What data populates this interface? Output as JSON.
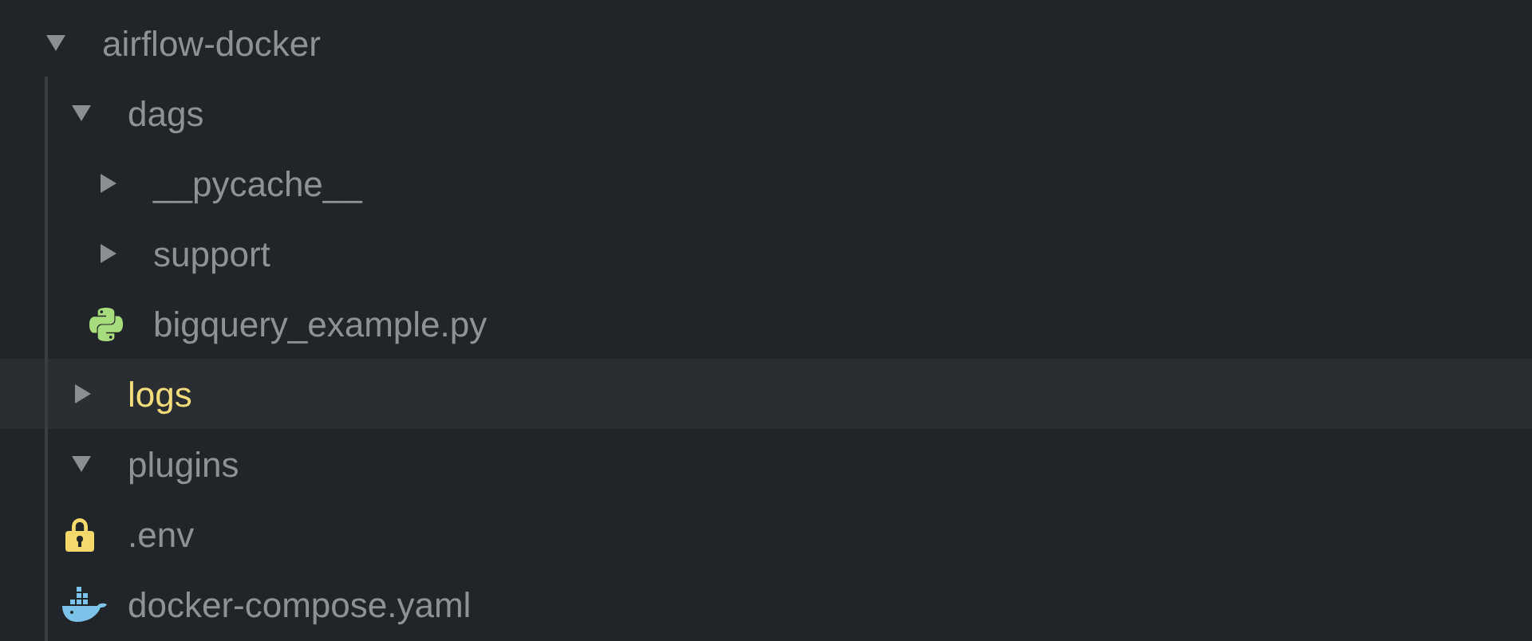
{
  "tree": [
    {
      "kind": "folder",
      "label": "airflow-docker",
      "expanded": true,
      "selected": false,
      "children": [
        {
          "kind": "folder",
          "label": "dags",
          "expanded": true,
          "selected": false,
          "children": [
            {
              "kind": "folder",
              "label": "__pycache__",
              "expanded": false,
              "selected": false
            },
            {
              "kind": "folder",
              "label": "support",
              "expanded": false,
              "selected": false
            },
            {
              "kind": "python",
              "label": "bigquery_example.py",
              "selected": false
            }
          ]
        },
        {
          "kind": "folder",
          "label": "logs",
          "expanded": false,
          "selected": true
        },
        {
          "kind": "folder",
          "label": "plugins",
          "expanded": true,
          "selected": false
        },
        {
          "kind": "lock",
          "label": ".env",
          "selected": false
        },
        {
          "kind": "docker",
          "label": "docker-compose.yaml",
          "selected": false
        }
      ]
    }
  ]
}
